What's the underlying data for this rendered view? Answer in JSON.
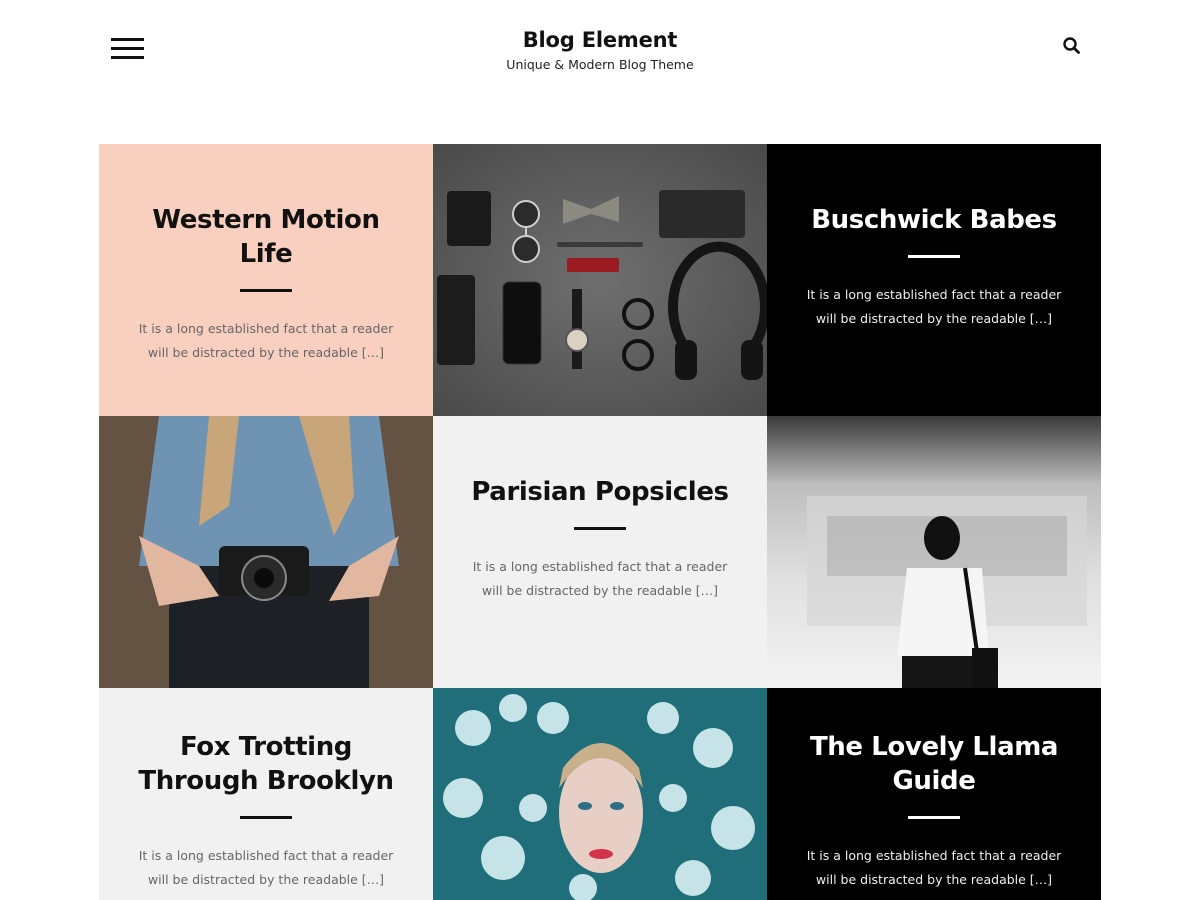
{
  "header": {
    "site_title": "Blog Element",
    "site_tagline": "Unique & Modern Blog Theme",
    "menu_icon": "hamburger-menu-icon",
    "search_icon": "search-icon"
  },
  "posts": [
    {
      "title": "Western Motion Life",
      "excerpt": "It is a long established fact that a reader will be distracted by the readable […]"
    },
    {
      "title": "Buschwick Babes",
      "excerpt": "It is a long established fact that a reader will be distracted by the readable […]"
    },
    {
      "title": "Parisian Popsicles",
      "excerpt": "It is a long established fact that a reader will be distracted by the readable […]"
    },
    {
      "title": "Fox Trotting Through Brooklyn",
      "excerpt": "It is a long established fact that a reader will be distracted by the readable […]"
    },
    {
      "title": "The Lovely Llama Guide",
      "excerpt": "It is a long established fact that a reader will be distracted by the readable […]"
    }
  ],
  "colors": {
    "peach": "#f9cfc0",
    "black": "#000000",
    "light_gray": "#f1f1f1"
  }
}
